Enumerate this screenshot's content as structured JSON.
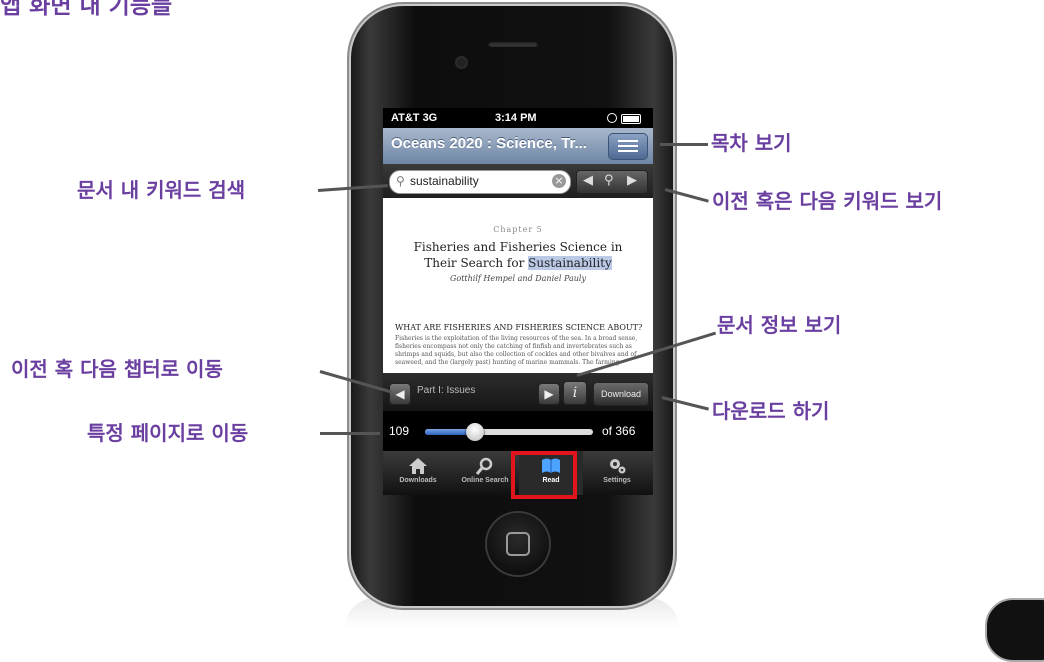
{
  "page_title": "앱 화면 내 기능들",
  "callouts": {
    "toc": "목차 보기",
    "keyword_search": "문서 내 키워드 검색",
    "prev_next_keyword": "이전 혹은 다음 키워드 보기",
    "doc_info": "문서 정보 보기",
    "prev_next_chapter": "이전 혹 다음 챕터로 이동",
    "download": "다운로드 하기",
    "goto_page": "특정 페이지로 이동"
  },
  "status_bar": {
    "carrier": "AT&T 3G",
    "time": "3:14 PM"
  },
  "nav": {
    "title": "Oceans 2020 : Science, Tr..."
  },
  "search": {
    "value": "sustainability"
  },
  "document": {
    "chapter": "Chapter 5",
    "title_line1": "Fisheries and Fisheries Science in",
    "title_line2_prefix": "Their Search for ",
    "title_line2_highlight": "Sustainability",
    "authors": "Gotthilf Hempel and Daniel Pauly",
    "section_heading": "WHAT ARE FISHERIES AND FISHERIES SCIENCE ABOUT?",
    "paragraph": "Fisheries is the exploitation of the living resources of the sea. In a broad sense, fisheries encompass not only the catching of finfish and invertebrates such as shrimps and squids, but also the collection of cockles and other bivalves and of seaweed, and the (largely past) hunting of marine mammals. The farming"
  },
  "chapter_bar": {
    "label": "Part I: Issues",
    "info_label": "i",
    "download_label": "Download"
  },
  "slider": {
    "current_page": "109",
    "total_label": "of 366",
    "progress": 0.298
  },
  "tabs": [
    {
      "label": "Downloads",
      "icon": "house-icon"
    },
    {
      "label": "Online Search",
      "icon": "magnifier-icon"
    },
    {
      "label": "Read",
      "icon": "book-icon"
    },
    {
      "label": "Settings",
      "icon": "gears-icon"
    }
  ],
  "colors": {
    "callout": "#6a3fa0",
    "highlight_box": "#e0161c",
    "nav_bar": "#7d93b3",
    "slider_fill": "#2d63c2"
  }
}
